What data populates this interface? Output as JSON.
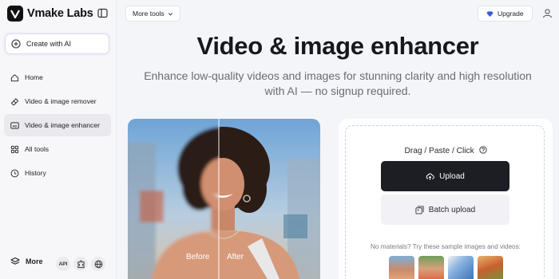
{
  "app": {
    "brand": "Vmake Labs"
  },
  "sidebar": {
    "create_label": "Create with AI",
    "items": [
      {
        "label": "Home",
        "icon": "home-icon",
        "active": false
      },
      {
        "label": "Video & image remover",
        "icon": "eraser-icon",
        "active": false
      },
      {
        "label": "Video & image enhancer",
        "icon": "hd-icon",
        "active": true
      },
      {
        "label": "All tools",
        "icon": "grid-icon",
        "active": false
      },
      {
        "label": "History",
        "icon": "clock-icon",
        "active": false
      }
    ],
    "more_label": "More",
    "api_label": "API"
  },
  "header": {
    "more_tools_label": "More tools",
    "upgrade_label": "Upgrade"
  },
  "hero": {
    "title": "Video & image enhancer",
    "subtitle": "Enhance low-quality videos and images for stunning clarity and high resolution with AI — no signup required."
  },
  "preview": {
    "before_label": "Before",
    "after_label": "After"
  },
  "upload": {
    "drag_text": "Drag / Paste / Click",
    "upload_label": "Upload",
    "batch_label": "Batch upload",
    "samples_text": "No materials? Try these sample images and videos:"
  },
  "colors": {
    "accent_dark": "#1c1e24",
    "background": "#f4f5f8",
    "upgrade_icon": "#3b5bdb"
  }
}
